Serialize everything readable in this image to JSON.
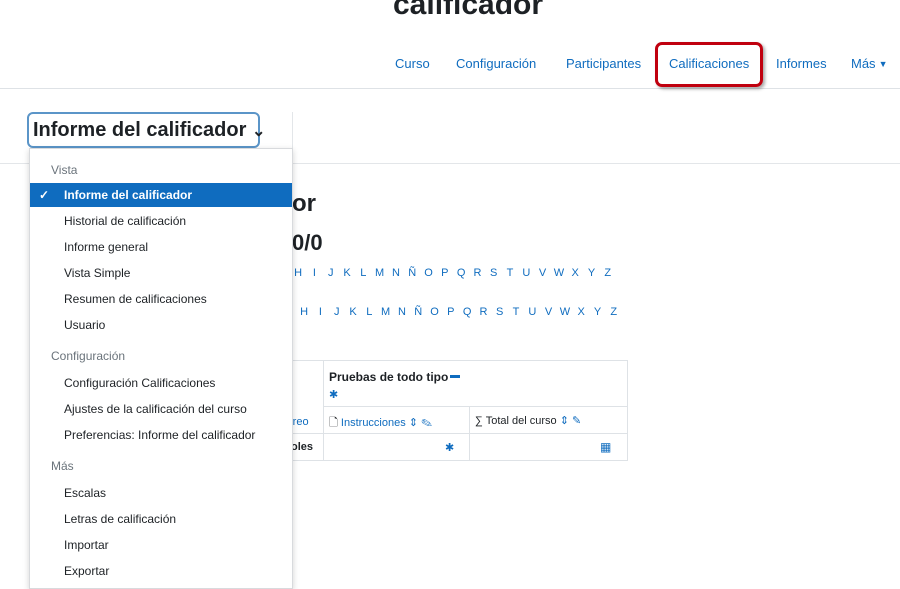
{
  "page": {
    "title": "calificador"
  },
  "nav": {
    "items": [
      "Curso",
      "Configuración",
      "Participantes",
      "Calificaciones",
      "Informes",
      "Más"
    ],
    "highlighted": "Calificaciones",
    "highlight_color": "#c0000f"
  },
  "selector": {
    "label": "Informe del calificador",
    "caret": "⌄"
  },
  "background": {
    "heading": "or",
    "score": "0/0",
    "letters_row1": [
      "H",
      "I",
      "J",
      "K",
      "L",
      "M",
      "N",
      "Ñ",
      "O",
      "P",
      "Q",
      "R",
      "S",
      "T",
      "U",
      "V",
      "W",
      "X",
      "Y",
      "Z"
    ],
    "letters_row2": [
      "H",
      "I",
      "J",
      "K",
      "L",
      "M",
      "N",
      "Ñ",
      "O",
      "P",
      "Q",
      "R",
      "S",
      "T",
      "U",
      "V",
      "W",
      "X",
      "Y",
      "Z"
    ],
    "table": {
      "category": "Pruebas de todo tipo",
      "col_email_partial": "rreo",
      "col_instructions": "Instrucciones",
      "col_total": "Total del curso",
      "row_partial": "oles"
    }
  },
  "menu": {
    "sections": [
      {
        "header": "Vista",
        "items": [
          "Informe del calificador",
          "Historial de calificación",
          "Informe general",
          "Vista Simple",
          "Resumen de calificaciones",
          "Usuario"
        ]
      },
      {
        "header": "Configuración",
        "items": [
          "Configuración Calificaciones",
          "Ajustes de la calificación del curso",
          "Preferencias: Informe del calificador"
        ]
      },
      {
        "header": "Más",
        "items": [
          "Escalas",
          "Letras de calificación",
          "Importar",
          "Exportar"
        ]
      }
    ],
    "active_item": "Informe del calificador",
    "accent_color": "#0f6cbf"
  }
}
